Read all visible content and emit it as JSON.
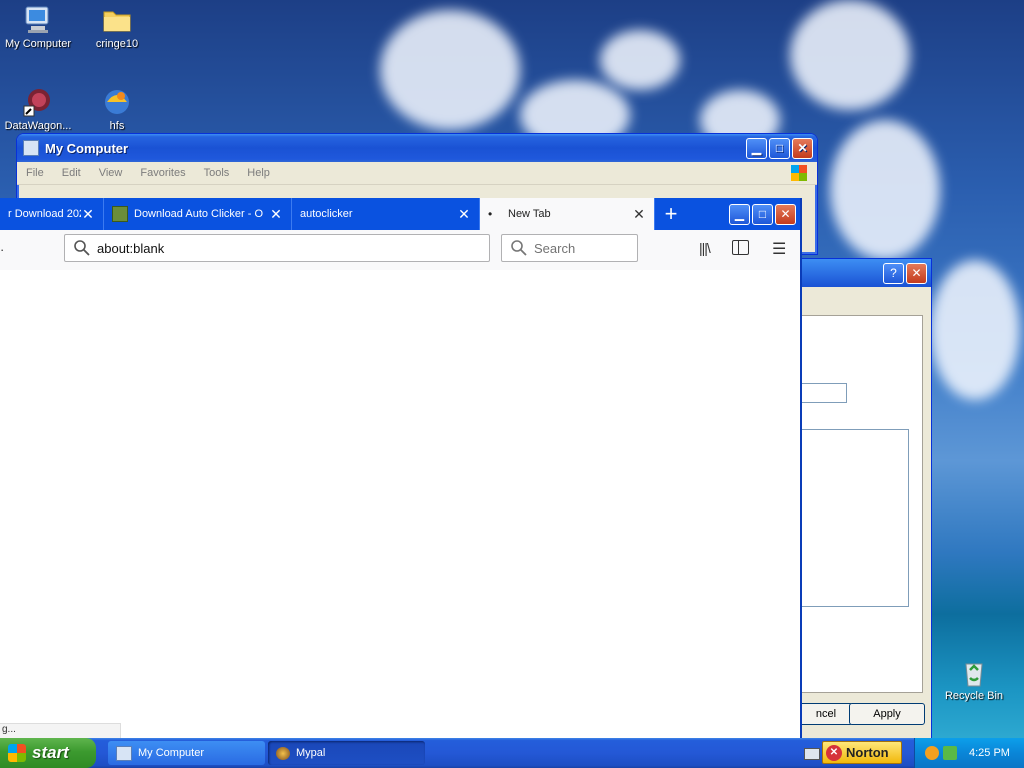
{
  "desktop": {
    "icons": [
      {
        "label": "My Computer"
      },
      {
        "label": "cringe10"
      },
      {
        "label": "DataWagon..."
      },
      {
        "label": "hfs"
      },
      {
        "label": "Recycle Bin"
      }
    ]
  },
  "my_computer_window": {
    "title": "My Computer",
    "menu": [
      "File",
      "Edit",
      "View",
      "Favorites",
      "Tools",
      "Help"
    ]
  },
  "browser": {
    "tabs": [
      {
        "label": "r Download 202"
      },
      {
        "label": "Download Auto Clicker - O"
      },
      {
        "label": "autoclicker"
      },
      {
        "label": "New Tab"
      }
    ],
    "url": "about:blank",
    "search_placeholder": "Search",
    "status_text": "g..."
  },
  "dialog": {
    "cancel_label": "ncel",
    "apply_label": "Apply"
  },
  "taskbar": {
    "start_label": "start",
    "buttons": [
      {
        "label": "My Computer"
      },
      {
        "label": "Mypal"
      }
    ],
    "norton_label": "Norton",
    "clock": "4:25 PM"
  }
}
